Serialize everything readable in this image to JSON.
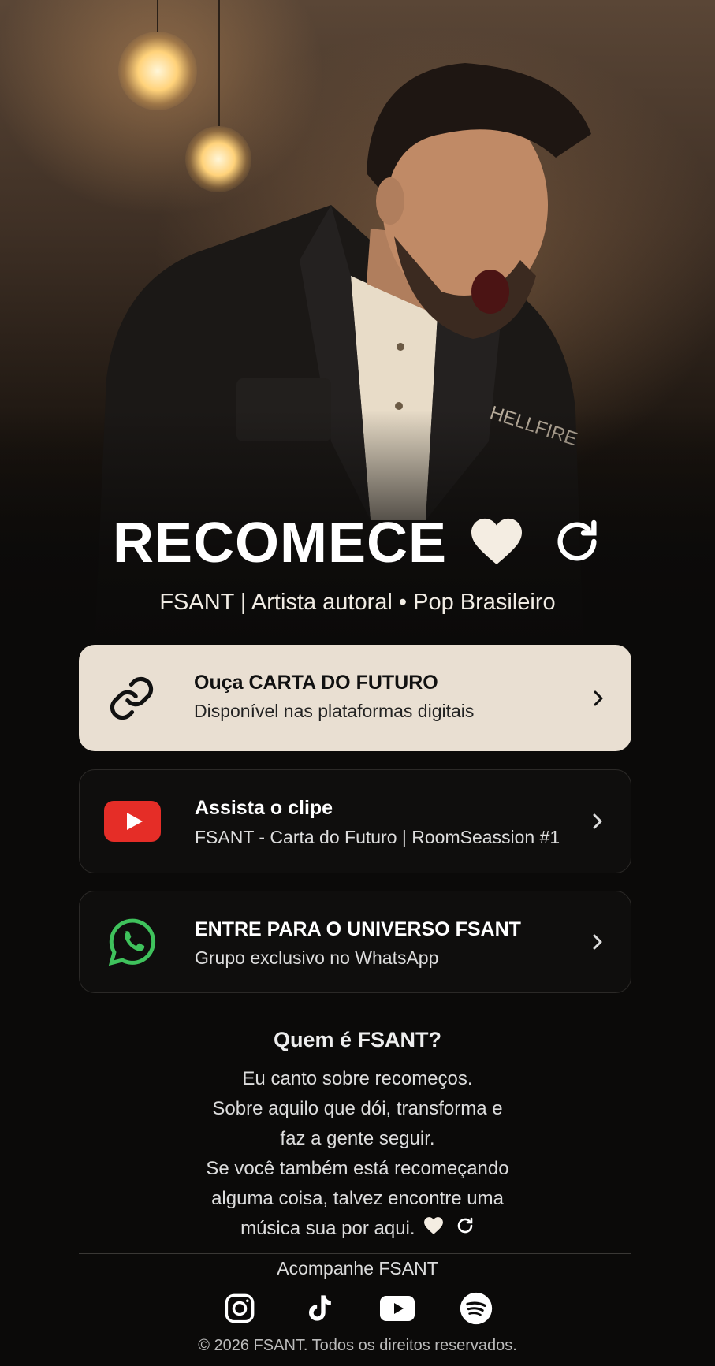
{
  "hero": {
    "title": "RECOMECE",
    "title_icons": [
      "heart-icon",
      "refresh-icon"
    ],
    "subtitle": "FSANT | Artista autoral • Pop Brasileiro"
  },
  "links": [
    {
      "icon": "link-icon",
      "title": "Ouça CARTA DO FUTURO",
      "subtitle": "Disponível nas plataformas digitais",
      "highlight": true
    },
    {
      "icon": "youtube-icon",
      "title": "Assista o clipe",
      "subtitle": "FSANT - Carta do Futuro | RoomSeassion #1",
      "highlight": false
    },
    {
      "icon": "whatsapp-icon",
      "title": "ENTRE PARA O UNIVERSO FSANT",
      "subtitle": "Grupo exclusivo no WhatsApp",
      "highlight": false
    }
  ],
  "about": {
    "title": "Quem é FSANT?",
    "lines": [
      "Eu canto sobre recomeços.",
      "Sobre aquilo que dói, transforma e",
      "faz a gente seguir.",
      "Se você também está recomeçando",
      "alguma coisa, talvez encontre uma",
      "música sua por aqui."
    ]
  },
  "footer": {
    "follow_label": "Acompanhe FSANT",
    "socials": [
      "instagram-icon",
      "tiktok-icon",
      "youtube-icon",
      "spotify-icon"
    ],
    "copyright": "© 2026 FSANT. Todos os direitos reservados."
  },
  "colors": {
    "background": "#0b0a09",
    "highlight_card": "#e9dfd2",
    "dark_card": "#0f0e0d",
    "youtube_red": "#e52d27",
    "whatsapp_green": "#3fc25c"
  }
}
